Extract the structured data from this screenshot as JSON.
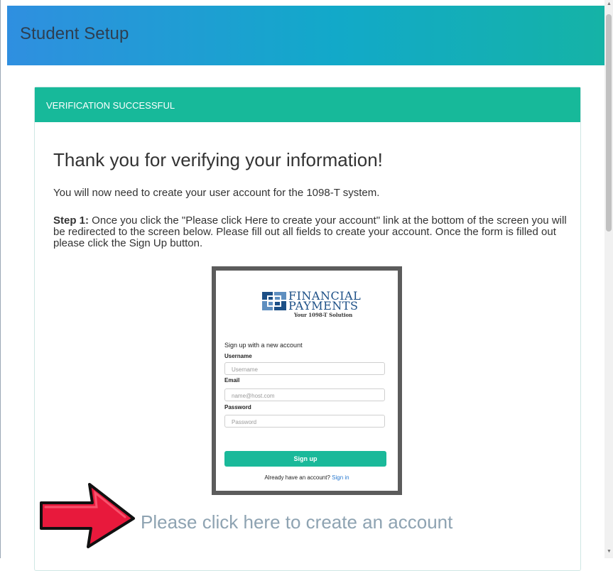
{
  "header": {
    "title": "Student Setup"
  },
  "panel": {
    "heading": "VERIFICATION SUCCESSFUL",
    "title": "Thank you for verifying your information!",
    "intro": "You will now need to create your user account for the 1098-T system.",
    "step_label": "Step 1:",
    "step_text": " Once you click the \"Please click Here to create your account\" link at the bottom of the screen you will be redirected to the screen below. Please fill out all fields to create your account. Once the form is filled out please click the Sign Up button."
  },
  "signup_preview": {
    "logo_line1": "FINANCIAL",
    "logo_line2": "PAYMENTS",
    "logo_tagline": "Your 1098-T Solution",
    "heading": "Sign up with a new account",
    "username_label": "Username",
    "username_placeholder": "Username",
    "email_label": "Email",
    "email_placeholder": "name@host.com",
    "password_label": "Password",
    "password_placeholder": "Password",
    "button": "Sign up",
    "footer_text": "Already have an account?",
    "footer_link": "Sign in"
  },
  "create_link": "Please click here to create an account",
  "colors": {
    "accent": "#17b99a",
    "header_gradient_start": "#2f8fe0",
    "header_gradient_end": "#15b3a6",
    "arrow": "#e8193c",
    "link": "#8ea3b2"
  },
  "icons": {
    "arrow": "red-pointing-arrow-icon",
    "logo": "financial-payments-logo-icon",
    "scroll_up": "scroll-up-arrow-icon",
    "scroll_down": "scroll-down-arrow-icon"
  }
}
